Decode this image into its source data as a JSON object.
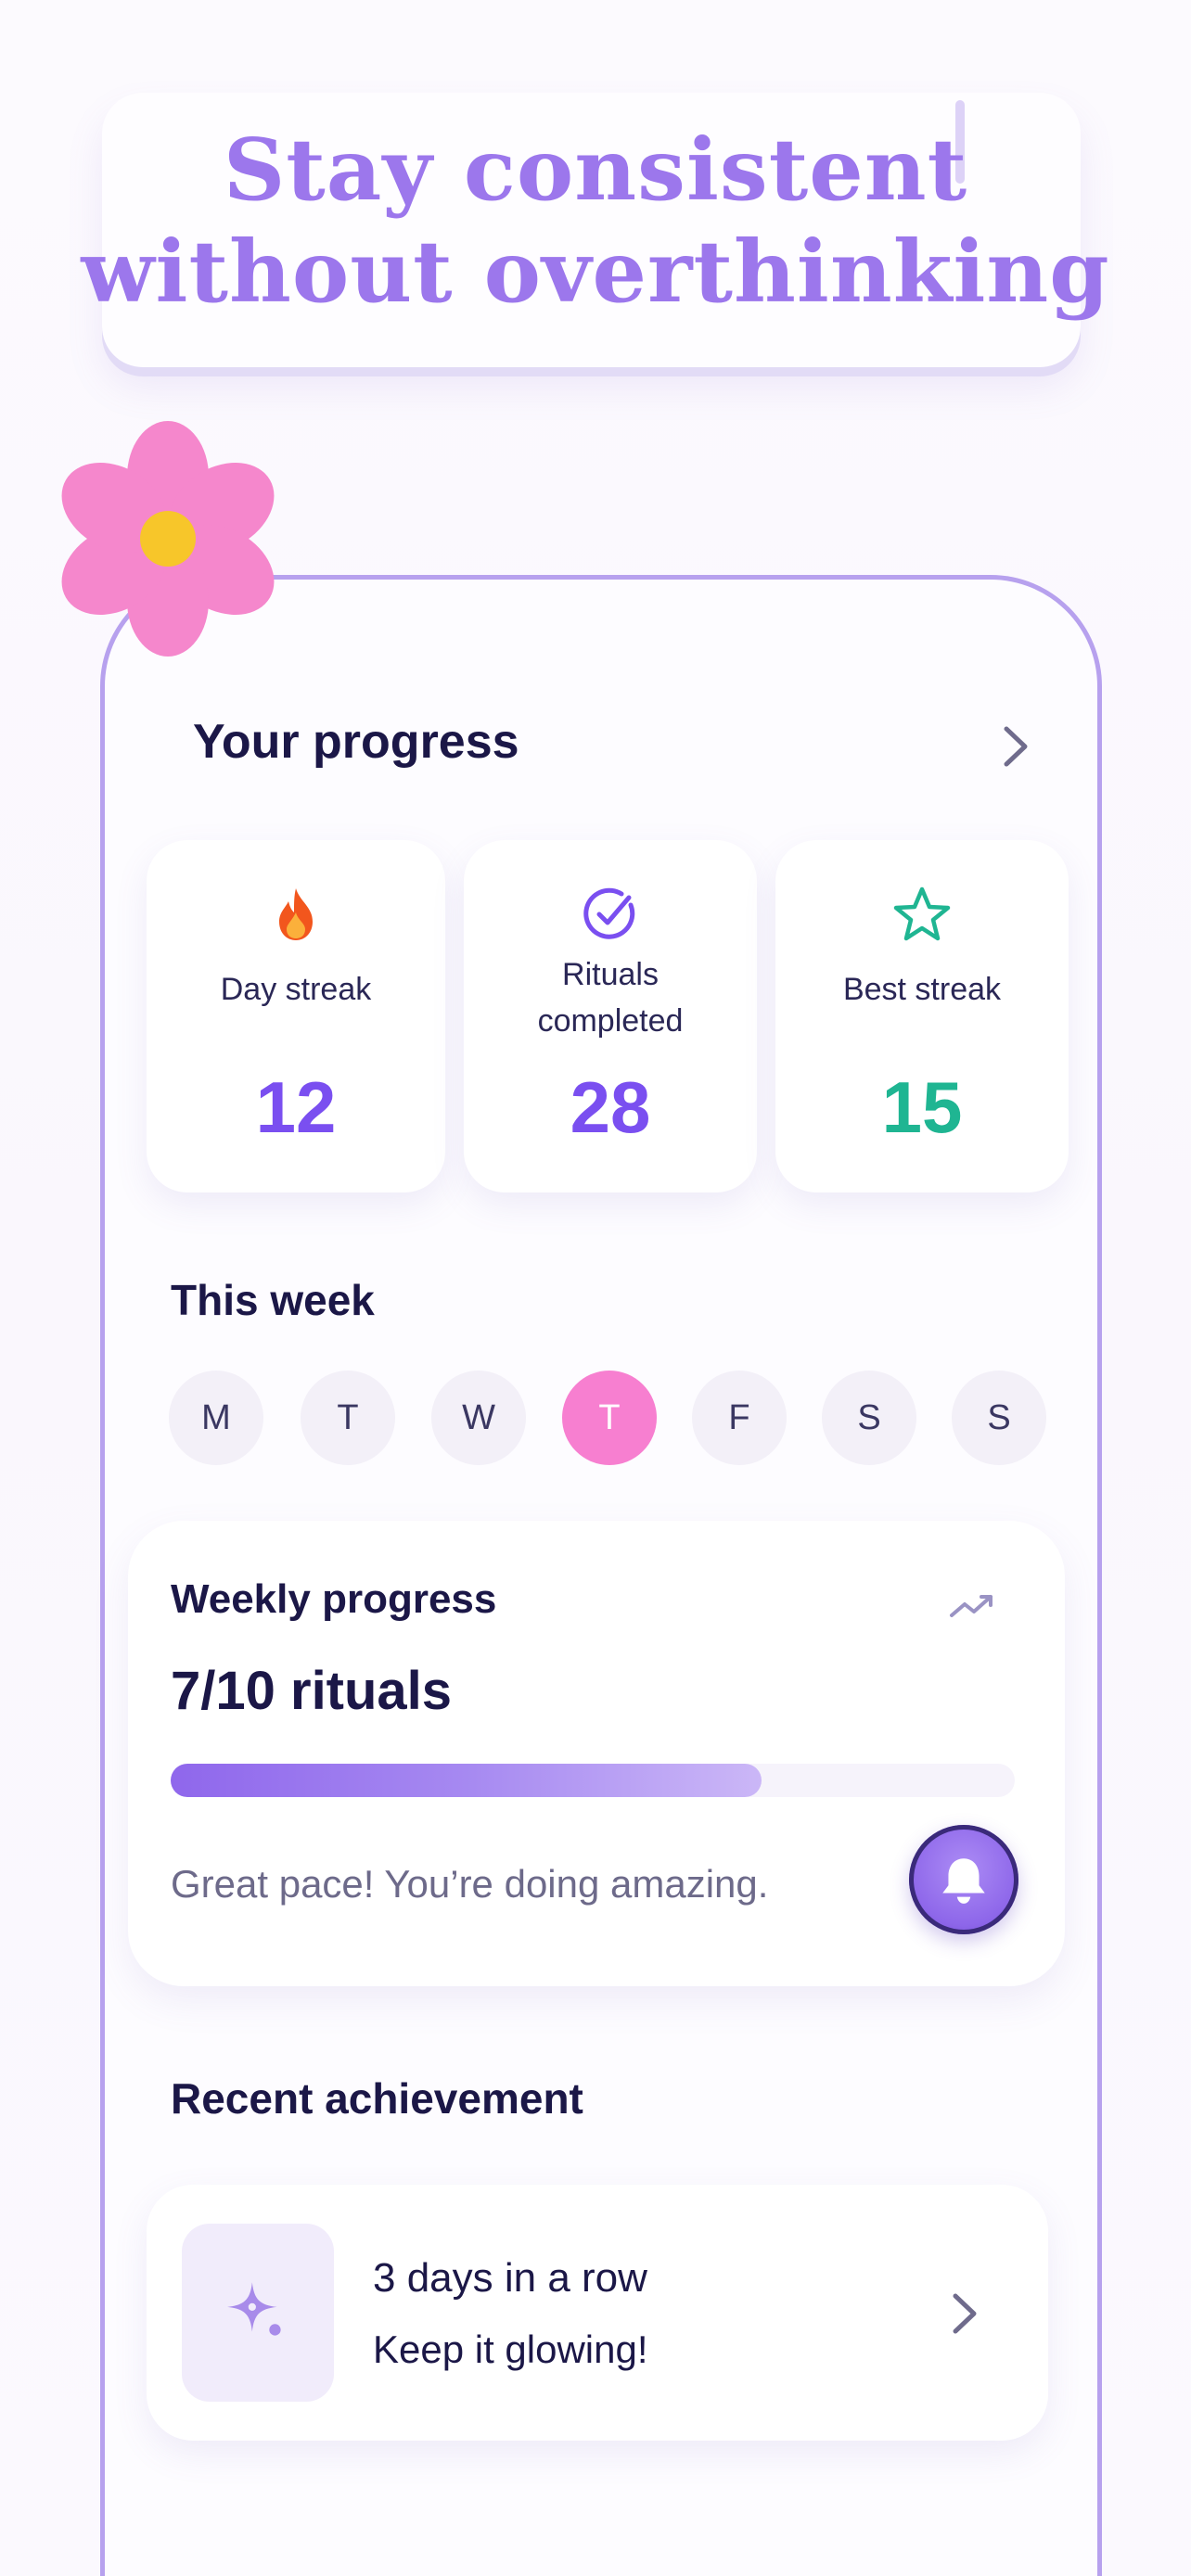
{
  "headline": {
    "line1": "Stay consistent",
    "line2": "without overthinking"
  },
  "progress": {
    "title": "Your progress",
    "stats": [
      {
        "label": "Day streak",
        "value": "12",
        "icon": "flame-icon",
        "color": "#7a4ff0"
      },
      {
        "label": "Rituals completed",
        "value": "28",
        "icon": "check-circle-icon",
        "color": "#7a4ff0"
      },
      {
        "label": "Best streak",
        "value": "15",
        "icon": "star-icon",
        "color": "#1fb592"
      }
    ]
  },
  "week": {
    "title": "This week",
    "days": [
      "M",
      "T",
      "W",
      "T",
      "F",
      "S",
      "S"
    ],
    "active_index": 3
  },
  "weekly_progress": {
    "label": "Weekly progress",
    "count": "7/10 rituals",
    "fraction": 0.7,
    "message": "Great pace! You’re doing amazing."
  },
  "achievement": {
    "section_title": "Recent achievement",
    "title": "3 days in a row",
    "subtitle": "Keep it glowing!"
  },
  "colors": {
    "accent": "#9c77ec",
    "pink": "#f77fd0",
    "green": "#1fb592"
  }
}
